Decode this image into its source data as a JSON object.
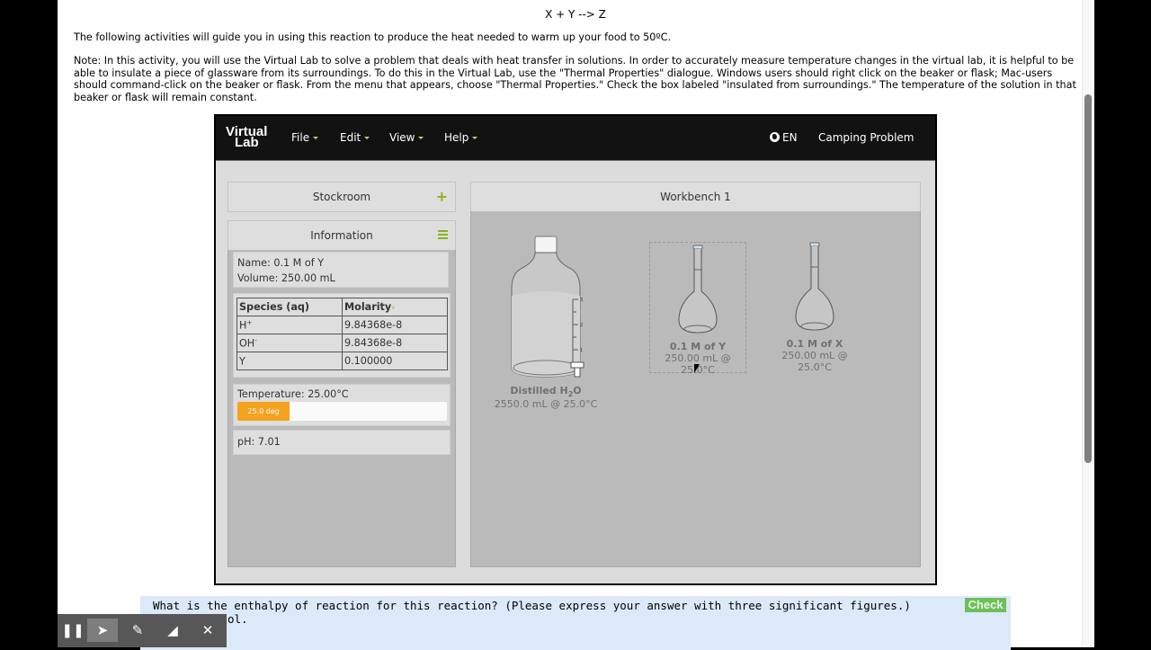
{
  "page": {
    "equation": "X + Y --> Z",
    "intro": "The following activities will guide you in using this reaction to produce the heat needed to warm up your food to 50ºC.",
    "note": "Note: In this activity, you will use the Virtual Lab to solve a problem that deals with heat transfer in solutions. In order to accurately measure temperature changes in the virtual lab, it is helpful to be able to insulate a piece of glassware from its surroundings. To do this in the Virtual Lab, use the \"Thermal Properties\" dialogue. Windows users should right click on the beaker or flask; Mac-users should command-click on the beaker or flask. From the menu that appears, choose \"Thermal Properties.\" Check the box labeled \"insulated from surroundings.\" The temperature of the solution in that beaker or flask will remain constant."
  },
  "vlab": {
    "logo_line1": "Virtual",
    "logo_line2": "Lab",
    "menus": [
      "File",
      "Edit",
      "View",
      "Help"
    ],
    "language": "EN",
    "problem_title": "Camping Problem",
    "stockroom_label": "Stockroom",
    "information_label": "Information",
    "workbench_label": "Workbench 1",
    "info": {
      "name": "Name: 0.1 M of Y",
      "volume": "Volume: 250.00 mL",
      "table_headers": [
        "Species (aq)",
        "Molarity"
      ],
      "rows": [
        {
          "species": "H",
          "sup": "+",
          "molarity": "9.84368e-8"
        },
        {
          "species": "OH",
          "sup": "-",
          "molarity": "9.84368e-8"
        },
        {
          "species": "Y",
          "sup": "",
          "molarity": "0.100000"
        }
      ],
      "temperature": "Temperature: 25.00°C",
      "temperature_bar_label": "25.0 deg",
      "temperature_bar_fraction": 0.25,
      "ph": "pH: 7.01"
    },
    "workbench_items": [
      {
        "label_main": "Distilled H",
        "label_sub": "2",
        "label_end": "O",
        "detail": "2550.0 mL @ 25.0°C"
      },
      {
        "label": "0.1 M of Y",
        "detail": "250.00 mL @ 25.0°C"
      },
      {
        "label": "0.1 M of X",
        "detail": "250.00 mL @ 25.0°C"
      }
    ],
    "jug_scale": [
      "3",
      "2",
      "1"
    ]
  },
  "question": {
    "text": "What is the enthalpy of reaction for this reaction? (Please express your answer with three significant figures.)",
    "text_line2_tail": "ol.",
    "check_label": "Check"
  },
  "toolbar": {
    "tools": [
      "pause",
      "pointer",
      "pen",
      "eraser",
      "close"
    ]
  },
  "colors": {
    "accent_green": "#8fb021",
    "temp_orange": "#f5a21f",
    "check_green": "#6fbe5a",
    "question_bg": "#dbe9f8"
  }
}
